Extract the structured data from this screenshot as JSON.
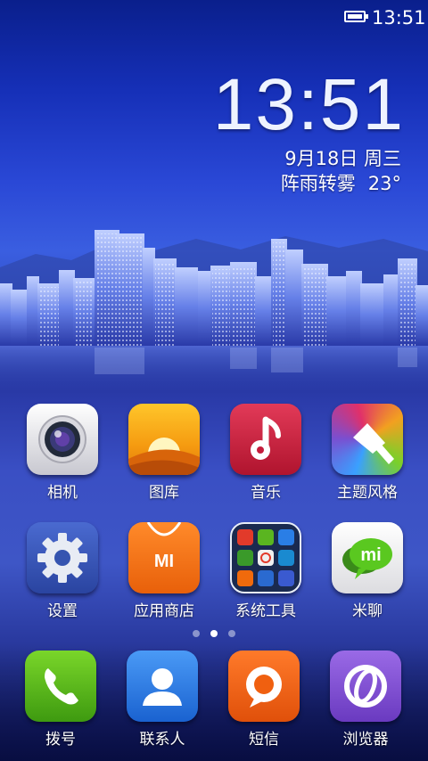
{
  "statusbar": {
    "time": "13:51",
    "battery_level": 1.0
  },
  "clock_widget": {
    "time": "13:51",
    "date": "9月18日 周三",
    "weather": "阵雨转雾",
    "temperature": "23°"
  },
  "apps_row1": [
    {
      "label": "相机",
      "icon": "camera-icon"
    },
    {
      "label": "图库",
      "icon": "gallery-icon"
    },
    {
      "label": "音乐",
      "icon": "music-icon"
    },
    {
      "label": "主题风格",
      "icon": "theme-brush-icon"
    }
  ],
  "apps_row2": [
    {
      "label": "设置",
      "icon": "gear-icon"
    },
    {
      "label": "应用商店",
      "icon": "mi-store-icon",
      "icon_text": "MI"
    },
    {
      "label": "系统工具",
      "icon": "folder-icon"
    },
    {
      "label": "米聊",
      "icon": "miliao-icon",
      "icon_text": "mi"
    }
  ],
  "page_indicator": {
    "pages": 3,
    "current": 2
  },
  "dock": [
    {
      "label": "拨号",
      "icon": "phone-icon"
    },
    {
      "label": "联系人",
      "icon": "contact-icon"
    },
    {
      "label": "短信",
      "icon": "message-icon"
    },
    {
      "label": "浏览器",
      "icon": "browser-icon"
    }
  ],
  "colors": {
    "camera": "#e8e8ec",
    "gallery": "#f49a10",
    "music": "#c41c3c",
    "theme": "#7a4fd0",
    "settings": "#3554b0",
    "store": "#f06a0c",
    "folder": "#1a2a50",
    "miliao": "#f4f4f4",
    "phone": "#5ab520",
    "contacts": "#2a7ee6",
    "messages": "#f06010",
    "browser": "#7a4ad0"
  }
}
